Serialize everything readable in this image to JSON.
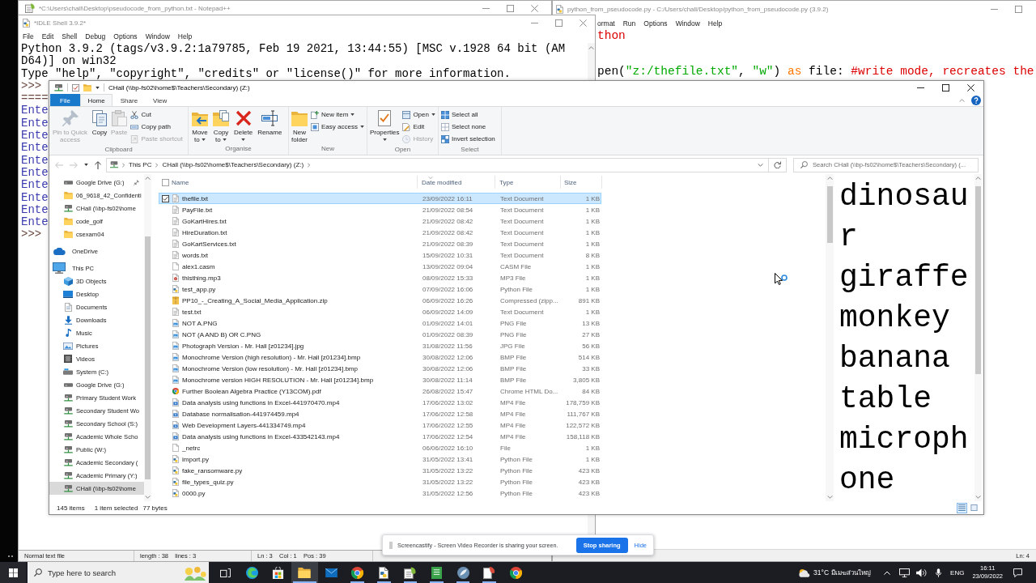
{
  "notepad": {
    "title": "*C:\\Users\\chall\\Desktop\\pseudocode_from_python.txt - Notepad++",
    "status_bar": [
      "Normal text file",
      "length : 38    lines : 3",
      "Ln : 3    Col : 1    Pos : 39"
    ]
  },
  "editor": {
    "title": "python_from_pseudocode.py - C:/Users/chall/Desktop/python_from_pseudocode.py (3.9.2)",
    "menu": [
      "ormat",
      "Run",
      "Options",
      "Window",
      "Help"
    ],
    "code": [
      {
        "tokens": [
          {
            "kind": "comment",
            "text": "thon"
          }
        ]
      },
      {
        "tokens": [
          {
            "kind": "plain",
            "text": "pen("
          },
          {
            "kind": "string",
            "text": "\"z:/thefile.txt\""
          },
          {
            "kind": "plain",
            "text": ", "
          },
          {
            "kind": "string",
            "text": "\"w\""
          },
          {
            "kind": "plain",
            "text": ") "
          },
          {
            "kind": "keyword",
            "text": "as"
          },
          {
            "kind": "plain",
            "text": " file: "
          },
          {
            "kind": "comment",
            "text": "#write mode, recreates the"
          }
        ]
      }
    ],
    "status": "Ln: 4"
  },
  "shell": {
    "title": "*IDLE Shell 3.9.2*",
    "menu": [
      "File",
      "Edit",
      "Shell",
      "Debug",
      "Options",
      "Window",
      "Help"
    ],
    "lines": [
      {
        "kind": "output",
        "text": "Python 3.9.2 (tags/v3.9.2:1a79785, Feb 19 2021, 13:44:55) [MSC v.1928 64 bit (AM"
      },
      {
        "kind": "output",
        "text": "D64)] on win32"
      },
      {
        "kind": "output",
        "text": "Type \"help\", \"copyright\", \"credits\" or \"license()\" for more information."
      },
      {
        "kind": "prompt",
        "text": ">>>"
      },
      {
        "kind": "restart",
        "text": "===="
      },
      {
        "kind": "stdout",
        "text": "Ente"
      },
      {
        "kind": "stdout",
        "text": "Ente"
      },
      {
        "kind": "stdout",
        "text": "Ente"
      },
      {
        "kind": "stdout",
        "text": "Ente"
      },
      {
        "kind": "stdout",
        "text": "Ente"
      },
      {
        "kind": "stdout",
        "text": "Ente"
      },
      {
        "kind": "stdout",
        "text": "Ente"
      },
      {
        "kind": "stdout",
        "text": "Ente"
      },
      {
        "kind": "stdout",
        "text": "Ente"
      },
      {
        "kind": "stdout",
        "text": "Ente"
      },
      {
        "kind": "prompt",
        "text": ">>>"
      }
    ]
  },
  "explorer": {
    "title": "CHall (\\\\bp-fs02\\home$\\Teachers\\Secondary) (Z:)",
    "tabs": [
      {
        "label": "File",
        "kind": "menu",
        "selected": false
      },
      {
        "label": "Home",
        "kind": "tab",
        "selected": true
      },
      {
        "label": "Share",
        "kind": "tab",
        "selected": false
      },
      {
        "label": "View",
        "kind": "tab",
        "selected": false
      }
    ],
    "ribbon": [
      {
        "label": "Clipboard",
        "large": [
          {
            "label": "Pin to Quick access",
            "disabled": true,
            "dropdown": false
          },
          {
            "label": "Copy",
            "disabled": false,
            "dropdown": false
          },
          {
            "label": "Paste",
            "disabled": true,
            "dropdown": false
          }
        ],
        "small": [
          {
            "label": "Cut",
            "disabled": false,
            "dropdown": false
          },
          {
            "label": "Copy path",
            "disabled": false,
            "dropdown": false
          },
          {
            "label": "Paste shortcut",
            "disabled": true,
            "dropdown": false
          }
        ]
      },
      {
        "label": "Organise",
        "large": [
          {
            "label": "Move to",
            "disabled": false,
            "dropdown": true
          },
          {
            "label": "Copy to",
            "disabled": false,
            "dropdown": true
          },
          {
            "label": "Delete",
            "disabled": false,
            "dropdown": true
          },
          {
            "label": "Rename",
            "disabled": false,
            "dropdown": false
          }
        ]
      },
      {
        "label": "New",
        "large": [
          {
            "label": "New folder",
            "disabled": false,
            "dropdown": false
          }
        ],
        "small": [
          {
            "label": "New item",
            "disabled": false,
            "dropdown": true
          },
          {
            "label": "Easy access",
            "disabled": false,
            "dropdown": true
          }
        ]
      },
      {
        "label": "Open",
        "large": [
          {
            "label": "Properties",
            "disabled": false,
            "dropdown": true
          }
        ],
        "small": [
          {
            "label": "Open",
            "disabled": false,
            "dropdown": true
          },
          {
            "label": "Edit",
            "disabled": false,
            "dropdown": false
          },
          {
            "label": "History",
            "disabled": true,
            "dropdown": false
          }
        ]
      },
      {
        "label": "Select",
        "small": [
          {
            "label": "Select all",
            "disabled": false,
            "dropdown": false
          },
          {
            "label": "Select none",
            "disabled": false,
            "dropdown": false
          },
          {
            "label": "Invert selection",
            "disabled": false,
            "dropdown": false
          }
        ]
      }
    ],
    "path": [
      "This PC",
      "CHall (\\\\bp-fs02\\home$\\Teachers\\Secondary) (Z:)"
    ],
    "search": {
      "placeholder": "Search CHall (\\\\bp-fs02\\home$\\Teachers\\Secondary) (..."
    },
    "nav": {
      "quick_access": [
        {
          "label": "Google Drive (G:)",
          "kind": "drive",
          "pinned": true,
          "selected": false
        },
        {
          "label": "06_9618_42_Confidenti",
          "kind": "folder",
          "pinned": false,
          "selected": false
        },
        {
          "label": "CHall (\\\\bp-fs02\\home",
          "kind": "network",
          "pinned": false,
          "selected": false
        },
        {
          "label": "code_golf",
          "kind": "folder",
          "pinned": false,
          "selected": false
        },
        {
          "label": "csexam04",
          "kind": "folder",
          "pinned": false,
          "selected": false
        }
      ],
      "items": [
        {
          "label": "OneDrive",
          "kind": "cloud",
          "selected": false
        },
        {
          "label": "This PC",
          "kind": "computer",
          "selected": false,
          "children": [
            {
              "label": "3D Objects",
              "kind": "objects",
              "selected": false
            },
            {
              "label": "Desktop",
              "kind": "desktop",
              "selected": false
            },
            {
              "label": "Documents",
              "kind": "documents",
              "selected": false
            },
            {
              "label": "Downloads",
              "kind": "downloads",
              "selected": false
            },
            {
              "label": "Music",
              "kind": "music",
              "selected": false
            },
            {
              "label": "Pictures",
              "kind": "pictures",
              "selected": false
            },
            {
              "label": "Videos",
              "kind": "videos",
              "selected": false
            },
            {
              "label": "System (C:)",
              "kind": "system",
              "selected": false
            },
            {
              "label": "Google Drive (G:)",
              "kind": "drive",
              "selected": false
            },
            {
              "label": "Primary Student Work",
              "kind": "network",
              "selected": false
            },
            {
              "label": "Secondary Student Wo",
              "kind": "network",
              "selected": false
            },
            {
              "label": "Secondary School (S:)",
              "kind": "network",
              "selected": false
            },
            {
              "label": "Academic Whole Scho",
              "kind": "network",
              "selected": false
            },
            {
              "label": "Public (W:)",
              "kind": "network",
              "selected": false
            },
            {
              "label": "Academic Secondary (",
              "kind": "network",
              "selected": false
            },
            {
              "label": "Academic Primary (Y:)",
              "kind": "network",
              "selected": false
            },
            {
              "label": "CHall (\\\\bp-fs02\\home",
              "kind": "network",
              "selected": true
            }
          ]
        }
      ]
    },
    "all_selected": false,
    "columns": [
      {
        "label": "Name",
        "sorted": false
      },
      {
        "label": "Date modified",
        "sorted": true
      },
      {
        "label": "Type",
        "sorted": false
      },
      {
        "label": "Size",
        "sorted": false
      }
    ],
    "files": [
      {
        "name": "thefile.txt",
        "date": "23/09/2022 16:11",
        "type": "Text Document",
        "size": "1 KB",
        "kind": "text",
        "selected": true
      },
      {
        "name": "PayFile.txt",
        "date": "21/09/2022 08:54",
        "type": "Text Document",
        "size": "1 KB",
        "kind": "text",
        "selected": false
      },
      {
        "name": "GoKartHires.txt",
        "date": "21/09/2022 08:42",
        "type": "Text Document",
        "size": "1 KB",
        "kind": "text",
        "selected": false
      },
      {
        "name": "HireDuration.txt",
        "date": "21/09/2022 08:42",
        "type": "Text Document",
        "size": "1 KB",
        "kind": "text",
        "selected": false
      },
      {
        "name": "GoKartServices.txt",
        "date": "21/09/2022 08:39",
        "type": "Text Document",
        "size": "1 KB",
        "kind": "text",
        "selected": false
      },
      {
        "name": "words.txt",
        "date": "15/09/2022 10:31",
        "type": "Text Document",
        "size": "8 KB",
        "kind": "text",
        "selected": false
      },
      {
        "name": "alex1.casm",
        "date": "13/09/2022 09:04",
        "type": "CASM File",
        "size": "1 KB",
        "kind": "blank",
        "selected": false
      },
      {
        "name": "thisthing.mp3",
        "date": "08/09/2022 15:33",
        "type": "MP3 File",
        "size": "1 KB",
        "kind": "audio",
        "selected": false
      },
      {
        "name": "test_app.py",
        "date": "07/09/2022 16:06",
        "type": "Python File",
        "size": "1 KB",
        "kind": "python",
        "selected": false
      },
      {
        "name": "PP10_-_Creating_A_Social_Media_Application.zip",
        "date": "06/09/2022 16:26",
        "type": "Compressed (zipp...",
        "size": "891 KB",
        "kind": "zip",
        "selected": false
      },
      {
        "name": "test.txt",
        "date": "06/09/2022 14:09",
        "type": "Text Document",
        "size": "1 KB",
        "kind": "text",
        "selected": false
      },
      {
        "name": "NOT A.PNG",
        "date": "01/09/2022 14:01",
        "type": "PNG File",
        "size": "13 KB",
        "kind": "image",
        "selected": false
      },
      {
        "name": "NOT (A AND B) OR C.PNG",
        "date": "01/09/2022 08:39",
        "type": "PNG File",
        "size": "27 KB",
        "kind": "image",
        "selected": false
      },
      {
        "name": "Photograph Version - Mr. Hall [z01234].jpg",
        "date": "31/08/2022 11:56",
        "type": "JPG File",
        "size": "56 KB",
        "kind": "image",
        "selected": false
      },
      {
        "name": "Monochrome Version (high resolution) - Mr. Hall [z01234].bmp",
        "date": "30/08/2022 12:06",
        "type": "BMP File",
        "size": "514 KB",
        "kind": "image",
        "selected": false
      },
      {
        "name": "Monochrome Version (low resolution) - Mr. Hall [z01234].bmp",
        "date": "30/08/2022 12:06",
        "type": "BMP File",
        "size": "33 KB",
        "kind": "image",
        "selected": false
      },
      {
        "name": "Monochrome version HIGH RESOLUTION - Mr. Hall [z01234].bmp",
        "date": "30/08/2022 11:14",
        "type": "BMP File",
        "size": "3,805 KB",
        "kind": "image",
        "selected": false
      },
      {
        "name": "Further Boolean Algebra Practice (Y13COM).pdf",
        "date": "26/08/2022 15:47",
        "type": "Chrome HTML Do...",
        "size": "84 KB",
        "kind": "web",
        "selected": false
      },
      {
        "name": "Data analysis using functions in Excel-441970470.mp4",
        "date": "17/06/2022 13:02",
        "type": "MP4 File",
        "size": "178,759 KB",
        "kind": "video",
        "selected": false
      },
      {
        "name": "Database normalisation-441974459.mp4",
        "date": "17/06/2022 12:58",
        "type": "MP4 File",
        "size": "111,767 KB",
        "kind": "video",
        "selected": false
      },
      {
        "name": "Web Development Layers-441334749.mp4",
        "date": "17/06/2022 12:55",
        "type": "MP4 File",
        "size": "122,572 KB",
        "kind": "video",
        "selected": false
      },
      {
        "name": "Data analysis using functions in Excel-433542143.mp4",
        "date": "17/06/2022 12:54",
        "type": "MP4 File",
        "size": "158,118 KB",
        "kind": "video",
        "selected": false
      },
      {
        "name": "_netrc",
        "date": "06/06/2022 16:10",
        "type": "File",
        "size": "1 KB",
        "kind": "blank",
        "selected": false
      },
      {
        "name": "import.py",
        "date": "31/05/2022 13:41",
        "type": "Python File",
        "size": "1 KB",
        "kind": "python",
        "selected": false
      },
      {
        "name": "fake_ransomware.py",
        "date": "31/05/2022 13:22",
        "type": "Python File",
        "size": "423 KB",
        "kind": "python",
        "selected": false
      },
      {
        "name": "file_types_quiz.py",
        "date": "31/05/2022 13:22",
        "type": "Python File",
        "size": "423 KB",
        "kind": "python",
        "selected": false
      },
      {
        "name": "0000.py",
        "date": "31/05/2022 12:56",
        "type": "Python File",
        "size": "423 KB",
        "kind": "python",
        "selected": false
      }
    ],
    "preview": [
      "dinosaur",
      "giraffe",
      "monkey",
      "banana",
      "table",
      "microphone"
    ],
    "status": {
      "count": "145 items",
      "selection": "1 item selected",
      "size": "77 bytes"
    },
    "views": [
      {
        "kind": "details",
        "selected": true
      },
      {
        "kind": "large_icons",
        "selected": false
      }
    ]
  },
  "sharing_bar": {
    "message": "Screencastify - Screen Video Recorder is sharing your screen.",
    "stop": "Stop sharing",
    "hide": "Hide"
  },
  "taskbar": {
    "search": {
      "placeholder": "Type here to search"
    },
    "apps": [
      {
        "active": false,
        "running": false
      },
      {
        "active": false,
        "running": false
      },
      {
        "active": true,
        "running": true
      },
      {
        "active": false,
        "running": false
      },
      {
        "active": false,
        "running": true
      },
      {
        "active": false,
        "running": true
      },
      {
        "active": false,
        "running": true
      },
      {
        "active": false,
        "running": true
      },
      {
        "active": false,
        "running": true
      },
      {
        "active": false,
        "running": true
      },
      {
        "active": false,
        "running": false
      }
    ],
    "weather": {
      "temperature": "31°C",
      "condition": "มีเมฆส่วนใหญ่"
    },
    "language": "ENG",
    "time": "16:11",
    "date": "23/09/2022"
  }
}
